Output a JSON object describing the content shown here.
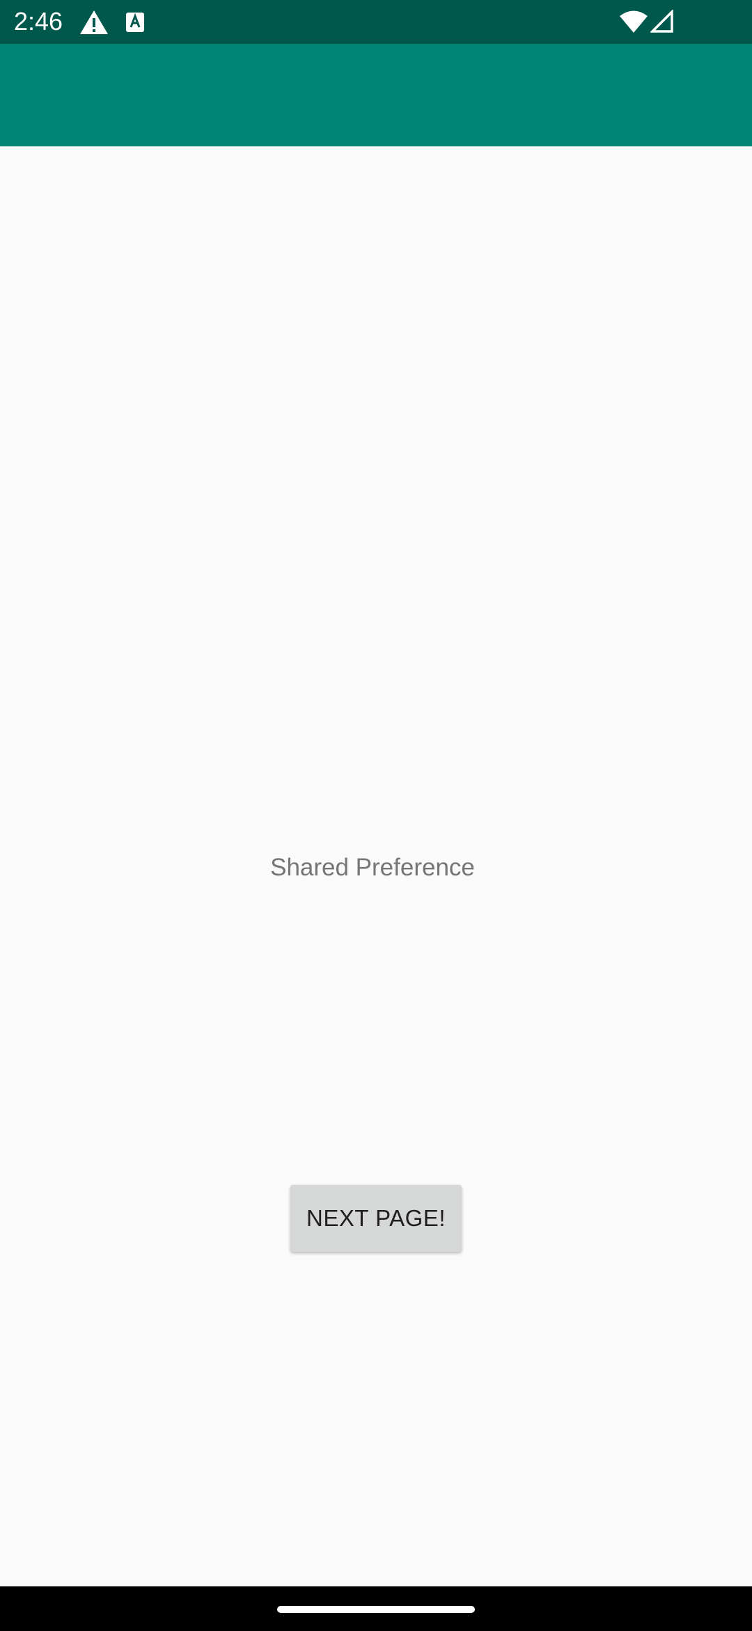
{
  "status_bar": {
    "time": "2:46",
    "icons": [
      "alert-icon",
      "keyboard-a-icon",
      "wifi-icon",
      "cell-signal-icon"
    ]
  },
  "app_bar": {
    "title": ""
  },
  "main": {
    "label": "Shared Preference",
    "button_label": "NEXT PAGE!"
  },
  "colors": {
    "status_bar": "#00574b",
    "app_bar": "#008577",
    "background": "#fafafa",
    "button": "#d6d7d7",
    "label_text": "#757575"
  }
}
